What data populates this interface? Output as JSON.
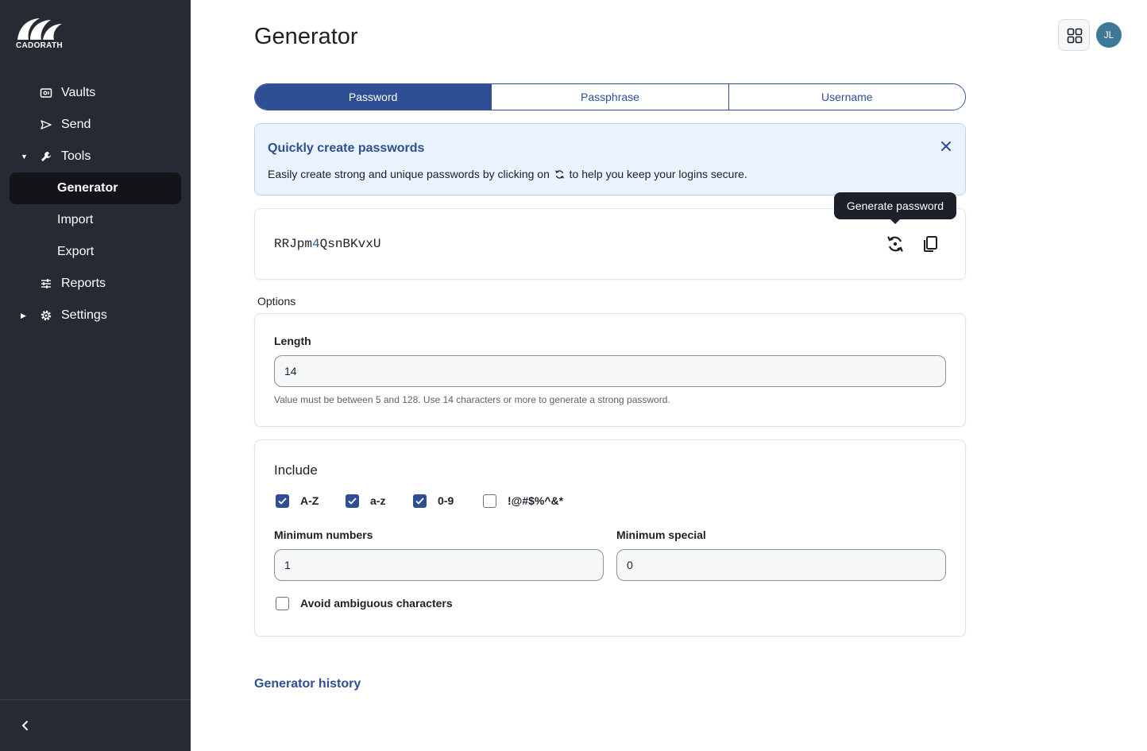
{
  "brand": {
    "name": "CADORATH"
  },
  "sidebar": {
    "items": [
      {
        "label": "Vaults",
        "icon": "vault-icon"
      },
      {
        "label": "Send",
        "icon": "send-icon"
      },
      {
        "label": "Tools",
        "icon": "wrench-icon",
        "expanded": true
      },
      {
        "label": "Generator",
        "active": true
      },
      {
        "label": "Import"
      },
      {
        "label": "Export"
      },
      {
        "label": "Reports",
        "icon": "sliders-icon"
      },
      {
        "label": "Settings",
        "icon": "gear-icon",
        "expanded": false
      }
    ]
  },
  "header": {
    "title": "Generator",
    "avatar_initials": "JL"
  },
  "tabs": [
    {
      "label": "Password",
      "active": true
    },
    {
      "label": "Passphrase"
    },
    {
      "label": "Username"
    }
  ],
  "callout": {
    "title": "Quickly create passwords",
    "text_before": "Easily create strong and unique passwords by clicking on",
    "text_after": "to help you keep your logins secure."
  },
  "generated": {
    "prefix": "RRJpm",
    "digit": "4",
    "suffix": "QsnBKvxU",
    "tooltip": "Generate password"
  },
  "options": {
    "label": "Options",
    "length_label": "Length",
    "length_value": "14",
    "length_hint": "Value must be between 5 and 128. Use 14 characters or more to generate a strong password.",
    "include_title": "Include",
    "checkboxes": [
      {
        "label": "A-Z",
        "checked": true
      },
      {
        "label": "a-z",
        "checked": true
      },
      {
        "label": "0-9",
        "checked": true
      },
      {
        "label": "!@#$%^&*",
        "checked": false
      }
    ],
    "min_numbers_label": "Minimum numbers",
    "min_numbers_value": "1",
    "min_special_label": "Minimum special",
    "min_special_value": "0",
    "avoid_ambiguous_label": "Avoid ambiguous characters",
    "avoid_ambiguous_checked": false
  },
  "history_link": "Generator history",
  "colors": {
    "sidebar_bg": "#262b33",
    "active_nav_bg": "#121418",
    "primary": "#2f4f95",
    "callout_bg": "#eaf3fd",
    "avatar_bg": "#3d7896"
  }
}
